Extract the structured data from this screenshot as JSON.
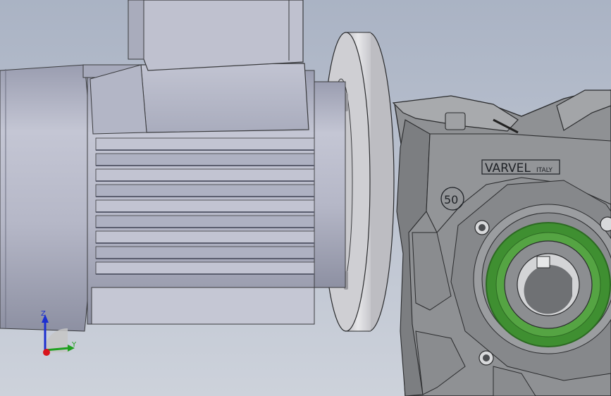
{
  "scene": {
    "colors": {
      "background_top": "#aeb6c6",
      "background_bottom": "#c9ced8",
      "motor_body": "#b7b9c9",
      "motor_shadow": "#7e8294",
      "flange": "#d4d4d8",
      "gearbox_body": "#8e9093",
      "gearbox_dark": "#5e6063",
      "seal_ring": "#3f8f31",
      "seal_ring_dark": "#2c6a22"
    },
    "gearbox": {
      "brand_main": "VARVEL",
      "brand_sub": "ITALY",
      "size_mark": "50"
    }
  },
  "triad": {
    "z_label": "Z",
    "y_label": "Y",
    "colors": {
      "x": "#d8141c",
      "y": "#1fa01f",
      "z": "#1c2fd0"
    }
  }
}
